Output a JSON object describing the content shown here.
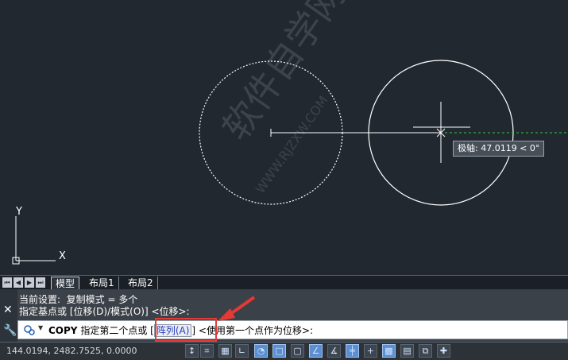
{
  "viewport": {
    "tooltip_text": "极轴: 47.0119 < 0°",
    "watermark_text": "软件自学网",
    "watermark_url": "WWW.RJZXW.COM",
    "ucs_x_label": "X",
    "ucs_y_label": "Y"
  },
  "layout_tabs": {
    "nav_buttons": [
      "⏮",
      "◀",
      "▶",
      "⏭"
    ],
    "tabs": [
      {
        "label": "模型",
        "active": true
      },
      {
        "label": "布局1",
        "active": false
      },
      {
        "label": "布局2",
        "active": false
      }
    ]
  },
  "command_panel": {
    "history": [
      "当前设置:  复制模式 = 多个",
      "指定基点或 [位移(D)/模式(O)] <位移>:"
    ],
    "close_glyph": "✕",
    "wrench_glyph": "🔧",
    "prompt": {
      "command": "COPY",
      "text_before": " 指定第二个点或 [",
      "option": "阵列(A)",
      "text_after": "] <使用第一个点作为位移>:"
    }
  },
  "status_bar": {
    "coordinates": "144.0194, 2482.7525, 0.0000"
  },
  "colors": {
    "canvas": "#212830",
    "highlight": "#e53935",
    "option_text": "#2a3ec0",
    "tracking_line": "#2ecc40"
  }
}
